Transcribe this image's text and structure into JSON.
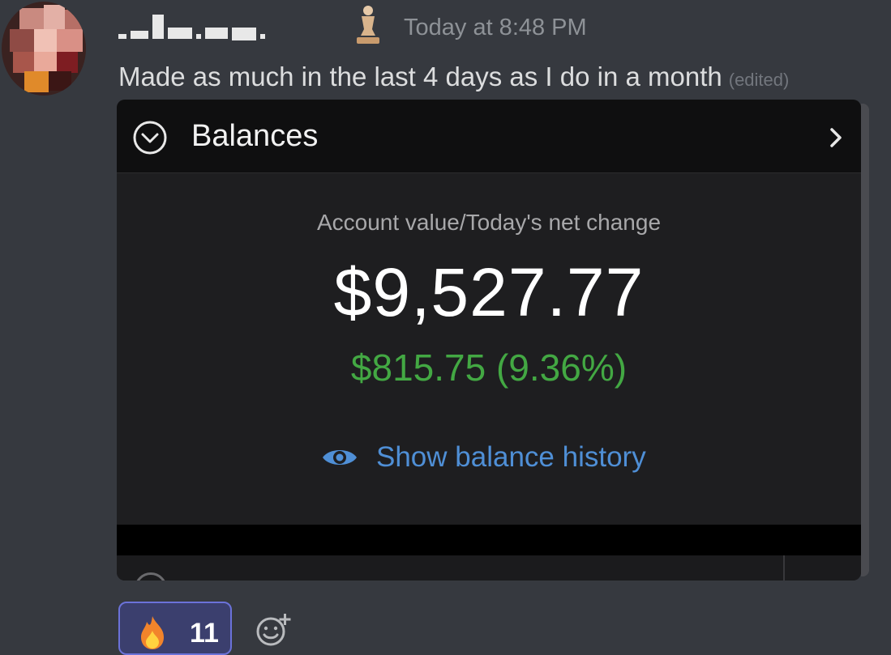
{
  "message": {
    "timestamp": "Today at 8:48 PM",
    "text": "Made as much in the last 4 days as I do in a month",
    "edited_label": "(edited)"
  },
  "embed": {
    "title": "Balances",
    "value_label": "Account value/Today's net change",
    "account_value": "$9,527.77",
    "net_change": "$815.75 (9.36%)",
    "history_link": "Show balance history"
  },
  "reactions": [
    {
      "icon": "fire-icon",
      "count": "11"
    }
  ],
  "colors": {
    "background": "#36393f",
    "gain_green": "#43a843",
    "link_blue": "#4f8fd6",
    "reaction_border": "#6b72d9"
  }
}
